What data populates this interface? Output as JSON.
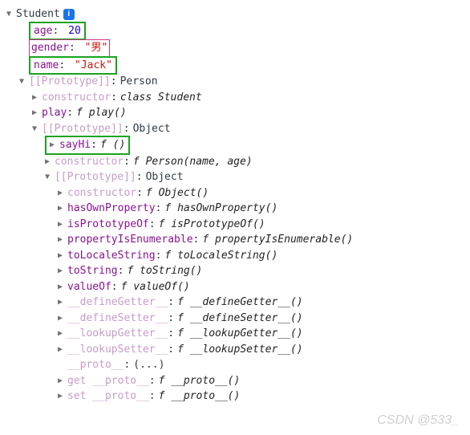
{
  "root": {
    "class": "Student",
    "props": {
      "age_key": "age",
      "age_val": "20",
      "gender_key": "gender",
      "gender_val": "\"男\"",
      "name_key": "name",
      "name_val": "\"Jack\""
    }
  },
  "proto1": {
    "label": "[[Prototype]]",
    "value": "Person",
    "constructor_key": "constructor",
    "constructor_val": "class Student",
    "play_key": "play",
    "play_val_f": "f",
    "play_val_name": "play()"
  },
  "proto2": {
    "label": "[[Prototype]]",
    "value": "Object",
    "sayHi_key": "sayHi",
    "sayHi_val_f": "f",
    "sayHi_val_name": "()",
    "constructor_key": "constructor",
    "constructor_val_f": "f",
    "constructor_val_name": "Person(name, age)"
  },
  "proto3": {
    "label": "[[Prototype]]",
    "value": "Object",
    "items": [
      {
        "key": "constructor",
        "f": "f",
        "name": "Object()"
      },
      {
        "key": "hasOwnProperty",
        "f": "f",
        "name": "hasOwnProperty()"
      },
      {
        "key": "isPrototypeOf",
        "f": "f",
        "name": "isPrototypeOf()"
      },
      {
        "key": "propertyIsEnumerable",
        "f": "f",
        "name": "propertyIsEnumerable()"
      },
      {
        "key": "toLocaleString",
        "f": "f",
        "name": "toLocaleString()"
      },
      {
        "key": "toString",
        "f": "f",
        "name": "toString()"
      },
      {
        "key": "valueOf",
        "f": "f",
        "name": "valueOf()"
      }
    ],
    "dim_items": [
      {
        "key": "__defineGetter__",
        "f": "f",
        "name": "__defineGetter__()"
      },
      {
        "key": "__defineSetter__",
        "f": "f",
        "name": "__defineSetter__()"
      },
      {
        "key": "__lookupGetter__",
        "f": "f",
        "name": "__lookupGetter__()"
      },
      {
        "key": "__lookupSetter__",
        "f": "f",
        "name": "__lookupSetter__()"
      }
    ],
    "proto_accessor": {
      "key": "__proto__",
      "val": "(...)"
    },
    "getset": [
      {
        "prefix": "get ",
        "key": "__proto__",
        "f": "f",
        "name": "__proto__()"
      },
      {
        "prefix": "set ",
        "key": "__proto__",
        "f": "f",
        "name": "__proto__()"
      }
    ]
  },
  "watermark": "CSDN @533_"
}
